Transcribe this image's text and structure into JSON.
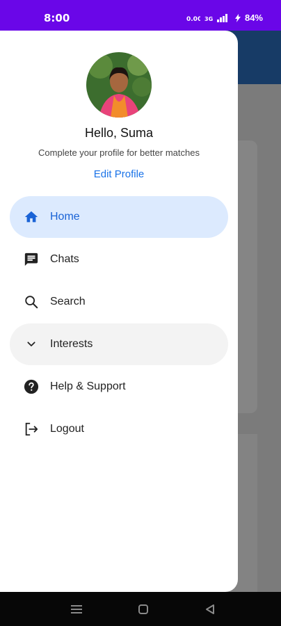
{
  "status_bar": {
    "time": "8:00",
    "battery": "84%",
    "icons": [
      "data-speed-icon",
      "network-icon",
      "signal-icon",
      "charging-icon"
    ]
  },
  "drawer": {
    "greeting": "Hello, Suma",
    "subtitle": "Complete your profile for better matches",
    "edit_profile": "Edit Profile",
    "items": [
      {
        "label": "Home",
        "icon": "home-icon",
        "active": true
      },
      {
        "label": "Chats",
        "icon": "chat-icon"
      },
      {
        "label": "Search",
        "icon": "search-icon"
      },
      {
        "label": "Interests",
        "icon": "chevron-down-icon",
        "expandable": true
      },
      {
        "label": "Help & Support",
        "icon": "help-icon"
      },
      {
        "label": "Logout",
        "icon": "logout-icon"
      }
    ]
  },
  "nav_bar": {
    "buttons": [
      "menu-icon",
      "home-square-icon",
      "back-triangle-icon"
    ]
  },
  "colors": {
    "status_bar": "#6a06e8",
    "accent": "#1a73e8",
    "active_item_bg": "#dceafe",
    "bg_header": "#173b66"
  }
}
